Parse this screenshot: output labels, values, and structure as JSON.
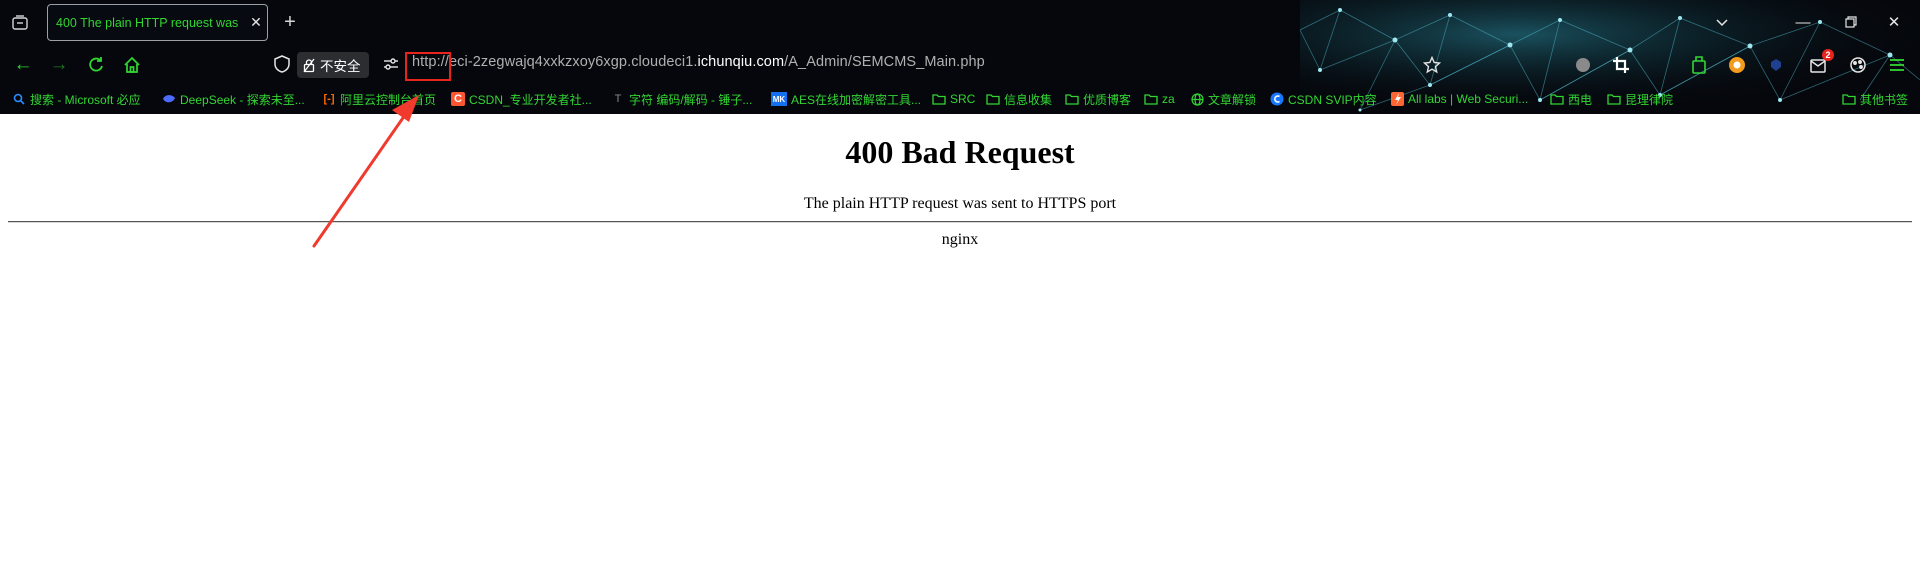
{
  "browser": {
    "tab": {
      "title": "400 The plain HTTP request was"
    },
    "address_bar": {
      "security_label": "不安全",
      "url_scheme": "http:",
      "url_sep": "//",
      "url_sub": "eci-2zegwajq4xxkzxoy6xgp.cloudeci1.",
      "url_domain": "ichunqiu.com",
      "url_path": "/A_Admin/SEMCMS_Main.php"
    },
    "notification_count": "2",
    "bookmarks": [
      {
        "label": "搜索 - Microsoft 必应",
        "icon": "search-icon"
      },
      {
        "label": "DeepSeek - 探索未至...",
        "icon": "deepseek-icon"
      },
      {
        "label": "阿里云控制台首页",
        "icon": "aliyun-icon"
      },
      {
        "label": "CSDN_专业开发者社...",
        "icon": "csdn-icon"
      },
      {
        "label": "字符 编码/解码 - 锤子...",
        "icon": "hammer-icon"
      },
      {
        "label": "AES在线加密解密工具...",
        "icon": "mk-icon"
      },
      {
        "label": "SRC",
        "icon": "folder-icon"
      },
      {
        "label": "信息收集",
        "icon": "folder-icon"
      },
      {
        "label": "优质博客",
        "icon": "folder-icon"
      },
      {
        "label": "za",
        "icon": "folder-icon"
      },
      {
        "label": "文章解锁",
        "icon": "globe-icon"
      },
      {
        "label": "CSDN SVIP内容",
        "icon": "csdn-svip-icon"
      },
      {
        "label": "All labs | Web Securi...",
        "icon": "portswigger-icon"
      },
      {
        "label": "西电",
        "icon": "folder-icon"
      },
      {
        "label": "昆理律院",
        "icon": "folder-icon"
      },
      {
        "label": "其他书签",
        "icon": "folder-icon"
      }
    ],
    "colors": {
      "accent": "#32d632",
      "highlight": "#e8241c"
    }
  },
  "page": {
    "title": "400 Bad Request",
    "message": "The plain HTTP request was sent to HTTPS port",
    "server": "nginx"
  }
}
